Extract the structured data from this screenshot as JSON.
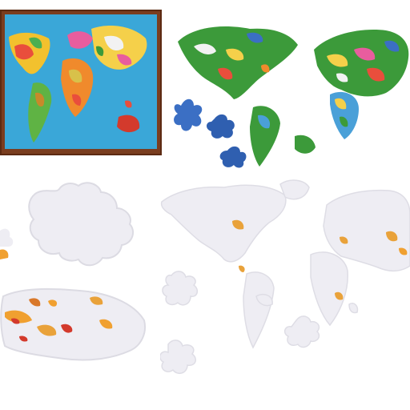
{
  "scene": {
    "panels": [
      {
        "name": "wooden-framed-colored-world-map-puzzle"
      },
      {
        "name": "colored-world-map-puzzle-with-loose-pieces"
      },
      {
        "name": "white-puzzle-pieces"
      },
      {
        "name": "white-world-map-puzzle"
      }
    ]
  },
  "colors": {
    "wood": "#7a3d1f",
    "ocean": "#3aa7d8",
    "land_green": "#3c9a3a",
    "land_blue": "#3b6fc4",
    "white_piece": "#eeedf3",
    "orange_accent": "#f0a030",
    "red_accent": "#d33a2c"
  }
}
